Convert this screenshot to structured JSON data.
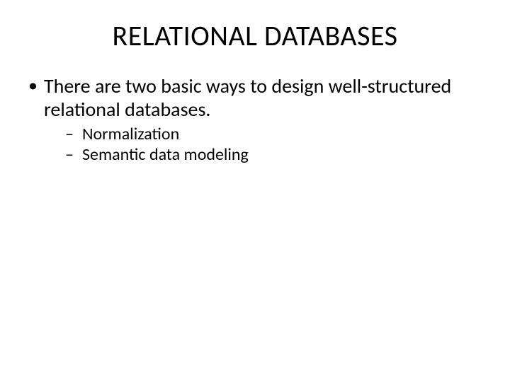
{
  "title": "RELATIONAL DATABASES",
  "bullets": [
    {
      "text": "There are two basic ways to design well-structured relational databases.",
      "sub": [
        "Normalization",
        "Semantic data modeling"
      ]
    }
  ]
}
